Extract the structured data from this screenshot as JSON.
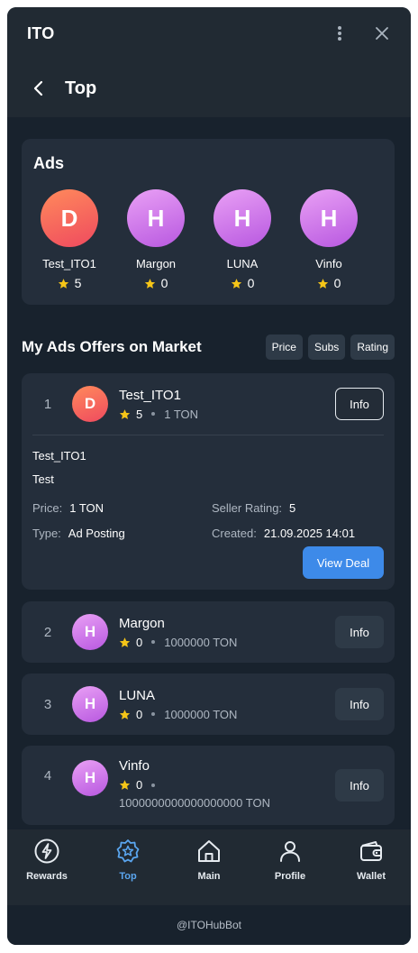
{
  "window": {
    "title": "ITO"
  },
  "header": {
    "title": "Top"
  },
  "ads": {
    "title": "Ads",
    "items": [
      {
        "initial": "D",
        "name": "Test_ITO1",
        "rating": "5"
      },
      {
        "initial": "H",
        "name": "Margon",
        "rating": "0"
      },
      {
        "initial": "H",
        "name": "LUNA",
        "rating": "0"
      },
      {
        "initial": "H",
        "name": "Vinfo",
        "rating": "0"
      }
    ]
  },
  "offers_section": {
    "title": "My Ads Offers on Market",
    "sort": [
      "Price",
      "Subs",
      "Rating"
    ]
  },
  "offers": [
    {
      "rank": "1",
      "initial": "D",
      "name": "Test_ITO1",
      "rating": "5",
      "price": "1 TON",
      "info_label": "Info",
      "details": {
        "title": "Test_ITO1",
        "description": "Test",
        "price_label": "Price:",
        "price_value": "1 TON",
        "seller_rating_label": "Seller Rating:",
        "seller_rating_value": "5",
        "type_label": "Type:",
        "type_value": "Ad Posting",
        "created_label": "Created:",
        "created_value": "21.09.2025 14:01",
        "view_deal_label": "View Deal"
      }
    },
    {
      "rank": "2",
      "initial": "H",
      "name": "Margon",
      "rating": "0",
      "price": "1000000 TON",
      "info_label": "Info"
    },
    {
      "rank": "3",
      "initial": "H",
      "name": "LUNA",
      "rating": "0",
      "price": "1000000 TON",
      "info_label": "Info"
    },
    {
      "rank": "4",
      "initial": "H",
      "name": "Vinfo",
      "rating": "0",
      "price": "1000000000000000000 TON",
      "info_label": "Info"
    }
  ],
  "tabs": [
    {
      "label": "Rewards",
      "icon": "lightning-icon"
    },
    {
      "label": "Top",
      "icon": "star-badge-icon",
      "active": true
    },
    {
      "label": "Main",
      "icon": "home-icon"
    },
    {
      "label": "Profile",
      "icon": "user-icon"
    },
    {
      "label": "Wallet",
      "icon": "wallet-icon"
    }
  ],
  "footer": {
    "text": "@ITOHubBot"
  },
  "colors": {
    "accent": "#3d8ae9",
    "active_tab": "#5aa6f0",
    "star": "#f5c518",
    "background": "#18222d",
    "card": "#242e3b"
  }
}
